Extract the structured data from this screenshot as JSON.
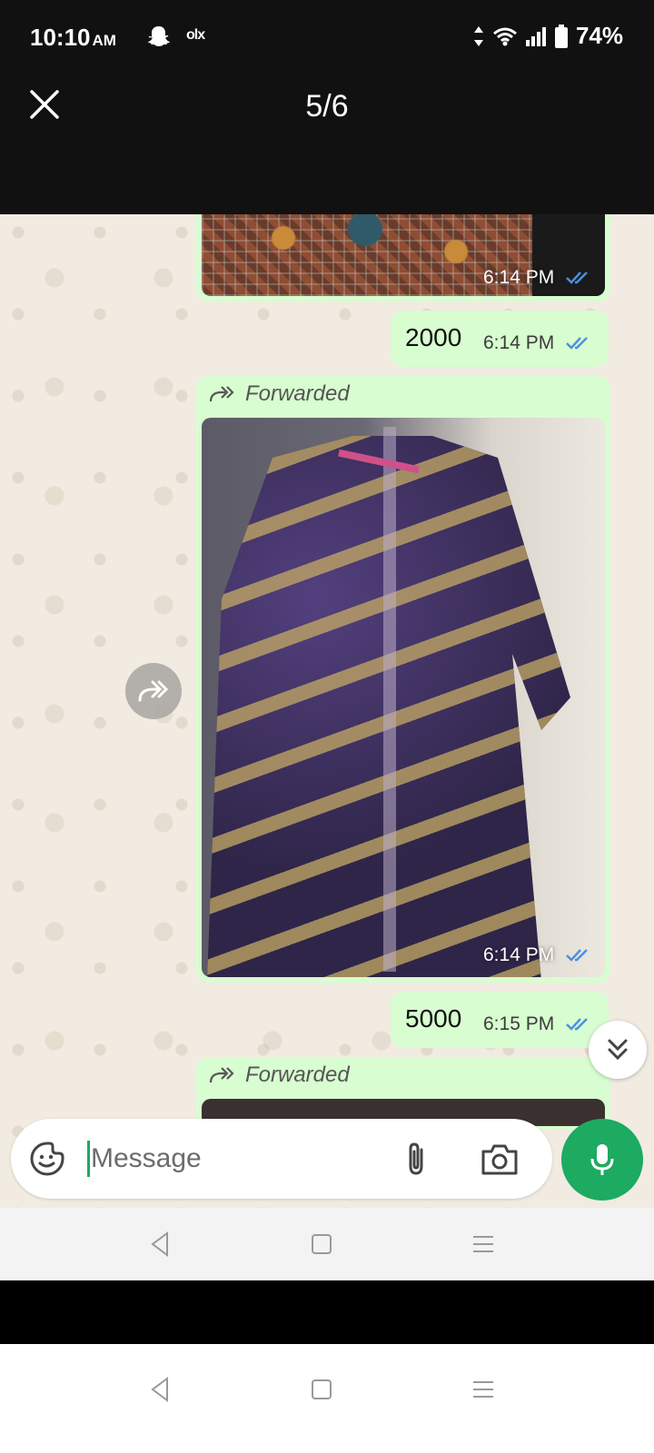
{
  "status_bar": {
    "time": "10:10",
    "ampm": "AM",
    "carrier_app": "olx",
    "battery": "74%"
  },
  "viewer": {
    "counter": "5/6"
  },
  "chat": {
    "messages": [
      {
        "type": "image",
        "time": "6:14 PM",
        "status": "read"
      },
      {
        "type": "text",
        "text": "2000",
        "time": "6:14 PM",
        "status": "read"
      },
      {
        "type": "forwarded-image",
        "forwarded_label": "Forwarded",
        "time": "6:14 PM",
        "status": "read"
      },
      {
        "type": "text",
        "text": "5000",
        "time": "6:15 PM",
        "status": "read"
      },
      {
        "type": "forwarded-image",
        "forwarded_label": "Forwarded"
      }
    ],
    "composer": {
      "placeholder": "Message"
    }
  },
  "colors": {
    "bubble_outgoing": "#d8fdd0",
    "accent": "#1daa61",
    "read_ticks": "#4a90e2",
    "chat_background": "#f1ebe1"
  }
}
